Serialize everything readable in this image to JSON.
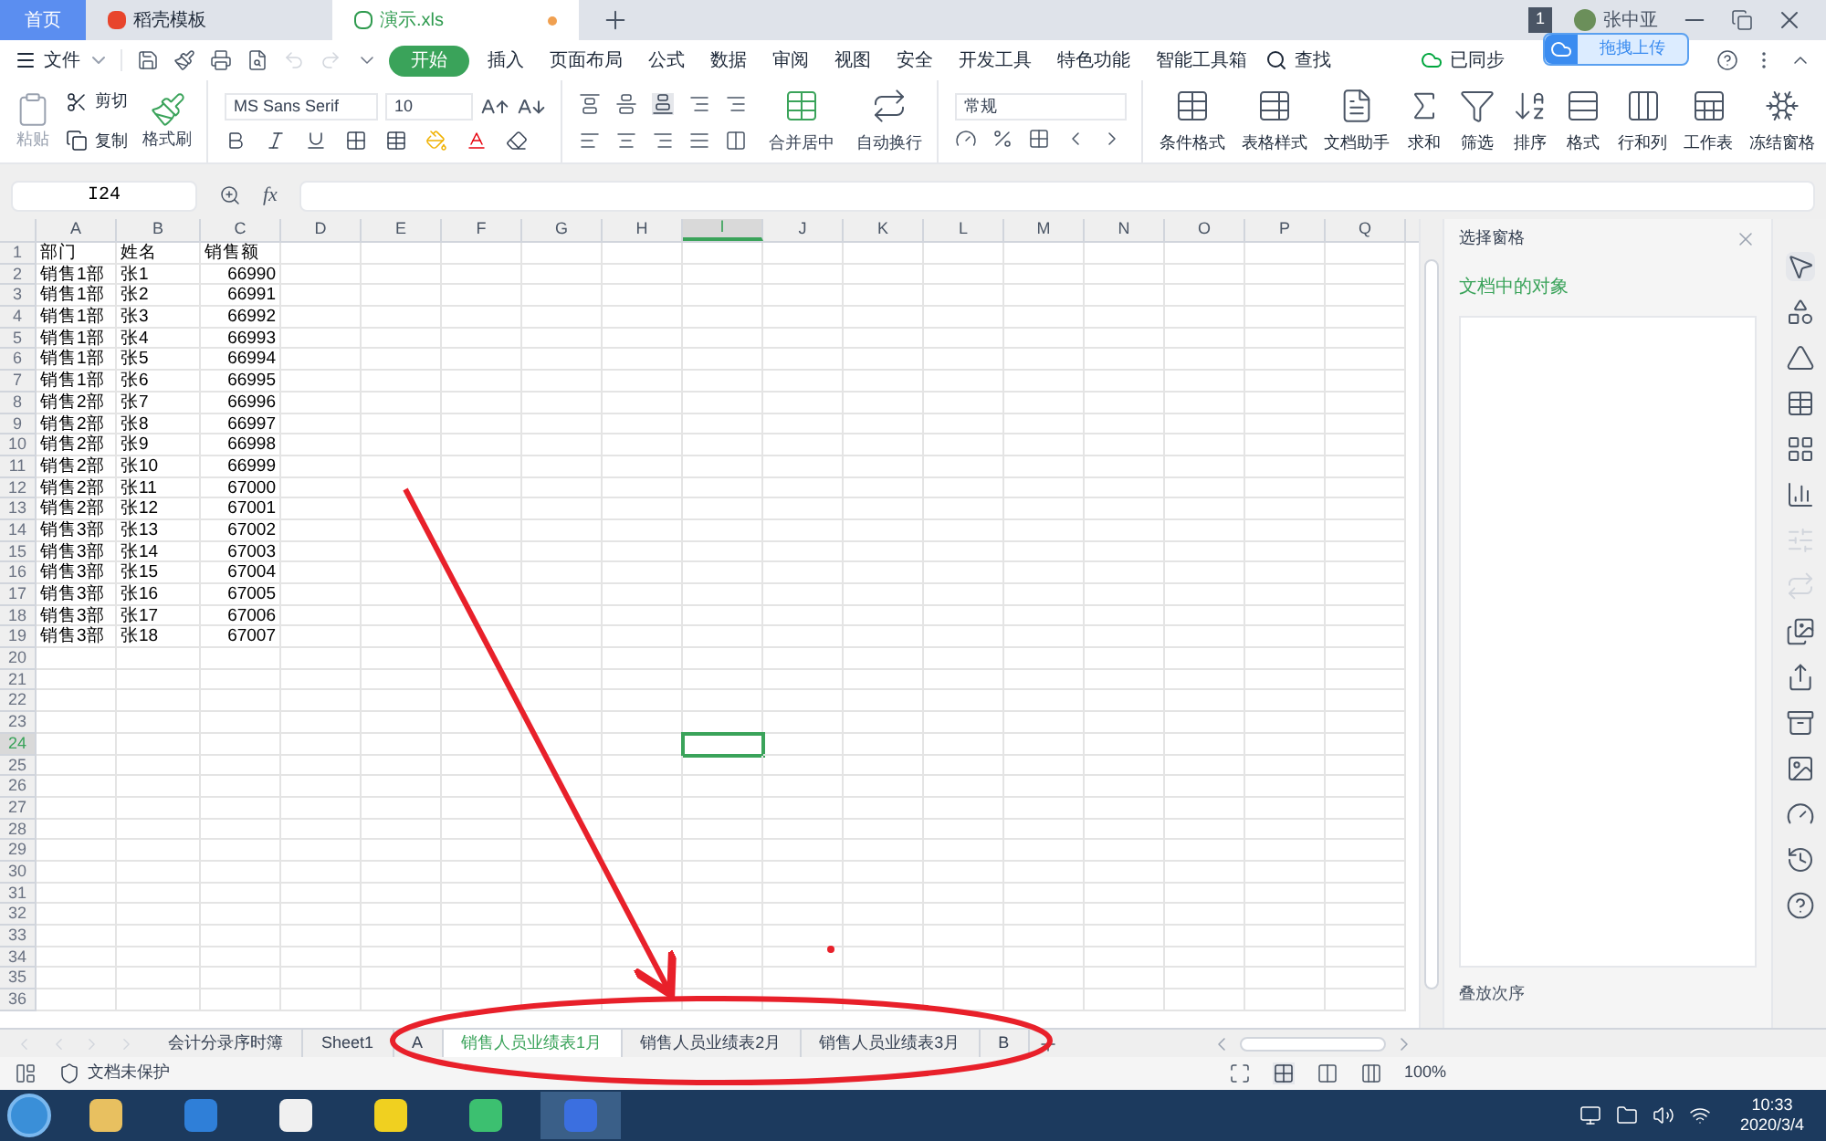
{
  "title_tabs": [
    {
      "label": "首页",
      "kind": "home",
      "selected": false
    },
    {
      "label": "稻壳模板",
      "kind": "template",
      "selected": false
    },
    {
      "label": "演示.xls",
      "kind": "sheet",
      "selected": true
    }
  ],
  "account": {
    "badge": "1",
    "user": "张中亚",
    "tooltip": "拖拽上传"
  },
  "menu": {
    "file": "文件",
    "tabs": [
      {
        "label": "开始",
        "selected": true
      },
      {
        "label": "插入",
        "selected": false
      },
      {
        "label": "页面布局",
        "selected": false
      },
      {
        "label": "公式",
        "selected": false
      },
      {
        "label": "数据",
        "selected": false
      },
      {
        "label": "审阅",
        "selected": false
      },
      {
        "label": "视图",
        "selected": false
      },
      {
        "label": "安全",
        "selected": false
      },
      {
        "label": "开发工具",
        "selected": false
      },
      {
        "label": "特色功能",
        "selected": false
      },
      {
        "label": "智能工具箱",
        "selected": false
      }
    ],
    "search": "查找",
    "sync": "已同步"
  },
  "ribbon": {
    "clipboard": {
      "paste": "粘贴",
      "cut": "剪切",
      "copy": "复制",
      "format_painter": "格式刷"
    },
    "font_name": "MS Sans Serif",
    "font_size": "10",
    "merge": "合并居中",
    "wrap": "自动换行",
    "number_format": "常规",
    "tools": [
      {
        "label": "条件格式",
        "kind": "cond"
      },
      {
        "label": "表格样式",
        "kind": "style"
      },
      {
        "label": "文档助手",
        "kind": "assist"
      },
      {
        "label": "求和",
        "kind": "sum"
      },
      {
        "label": "筛选",
        "kind": "filter"
      },
      {
        "label": "排序",
        "kind": "sort"
      },
      {
        "label": "格式",
        "kind": "format"
      },
      {
        "label": "行和列",
        "kind": "rowcol"
      },
      {
        "label": "工作表",
        "kind": "sheet"
      },
      {
        "label": "冻结窗格",
        "kind": "freeze"
      }
    ]
  },
  "formula_bar": {
    "name_box": "I24",
    "function_button": "fx"
  },
  "grid": {
    "columns": [
      {
        "label": "A",
        "selected": false
      },
      {
        "label": "B",
        "selected": false
      },
      {
        "label": "C",
        "selected": false
      },
      {
        "label": "D",
        "selected": false
      },
      {
        "label": "E",
        "selected": false
      },
      {
        "label": "F",
        "selected": false
      },
      {
        "label": "G",
        "selected": false
      },
      {
        "label": "H",
        "selected": false
      },
      {
        "label": "I",
        "selected": true
      },
      {
        "label": "J",
        "selected": false
      },
      {
        "label": "K",
        "selected": false
      },
      {
        "label": "L",
        "selected": false
      },
      {
        "label": "M",
        "selected": false
      },
      {
        "label": "N",
        "selected": false
      },
      {
        "label": "O",
        "selected": false
      },
      {
        "label": "P",
        "selected": false
      },
      {
        "label": "Q",
        "selected": false
      }
    ],
    "rows": [
      {
        "number": "1",
        "active": false,
        "cells": [
          "部门",
          "姓名",
          "销售额"
        ]
      },
      {
        "number": "2",
        "active": false,
        "cells": [
          "销售1部",
          "张1",
          "66990"
        ]
      },
      {
        "number": "3",
        "active": false,
        "cells": [
          "销售1部",
          "张2",
          "66991"
        ]
      },
      {
        "number": "4",
        "active": false,
        "cells": [
          "销售1部",
          "张3",
          "66992"
        ]
      },
      {
        "number": "5",
        "active": false,
        "cells": [
          "销售1部",
          "张4",
          "66993"
        ]
      },
      {
        "number": "6",
        "active": false,
        "cells": [
          "销售1部",
          "张5",
          "66994"
        ]
      },
      {
        "number": "7",
        "active": false,
        "cells": [
          "销售1部",
          "张6",
          "66995"
        ]
      },
      {
        "number": "8",
        "active": false,
        "cells": [
          "销售2部",
          "张7",
          "66996"
        ]
      },
      {
        "number": "9",
        "active": false,
        "cells": [
          "销售2部",
          "张8",
          "66997"
        ]
      },
      {
        "number": "10",
        "active": false,
        "cells": [
          "销售2部",
          "张9",
          "66998"
        ]
      },
      {
        "number": "11",
        "active": false,
        "cells": [
          "销售2部",
          "张10",
          "66999"
        ]
      },
      {
        "number": "12",
        "active": false,
        "cells": [
          "销售2部",
          "张11",
          "67000"
        ]
      },
      {
        "number": "13",
        "active": false,
        "cells": [
          "销售2部",
          "张12",
          "67001"
        ]
      },
      {
        "number": "14",
        "active": false,
        "cells": [
          "销售3部",
          "张13",
          "67002"
        ]
      },
      {
        "number": "15",
        "active": false,
        "cells": [
          "销售3部",
          "张14",
          "67003"
        ]
      },
      {
        "number": "16",
        "active": false,
        "cells": [
          "销售3部",
          "张15",
          "67004"
        ]
      },
      {
        "number": "17",
        "active": false,
        "cells": [
          "销售3部",
          "张16",
          "67005"
        ]
      },
      {
        "number": "18",
        "active": false,
        "cells": [
          "销售3部",
          "张17",
          "67006"
        ]
      },
      {
        "number": "19",
        "active": false,
        "cells": [
          "销售3部",
          "张18",
          "67007"
        ]
      },
      {
        "number": "20",
        "active": false
      },
      {
        "number": "21",
        "active": false
      },
      {
        "number": "22",
        "active": false
      },
      {
        "number": "23",
        "active": false
      },
      {
        "number": "24",
        "active": true
      },
      {
        "number": "25",
        "active": false
      },
      {
        "number": "26",
        "active": false
      },
      {
        "number": "27",
        "active": false
      },
      {
        "number": "28",
        "active": false
      },
      {
        "number": "29",
        "active": false
      },
      {
        "number": "30",
        "active": false
      },
      {
        "number": "31",
        "active": false
      },
      {
        "number": "32",
        "active": false
      },
      {
        "number": "33",
        "active": false
      },
      {
        "number": "34",
        "active": false
      },
      {
        "number": "35",
        "active": false
      },
      {
        "number": "36",
        "active": false
      }
    ]
  },
  "sheet_tabs": [
    {
      "label": "会计分录序时簿",
      "selected": false
    },
    {
      "label": "Sheet1",
      "selected": false
    },
    {
      "label": "A",
      "selected": false
    },
    {
      "label": "销售人员业绩表1月",
      "selected": true
    },
    {
      "label": "销售人员业绩表2月",
      "selected": false
    },
    {
      "label": "销售人员业绩表3月",
      "selected": false
    },
    {
      "label": "B",
      "selected": false
    }
  ],
  "status_bar": {
    "protection": "文档未保护",
    "zoom": "100%"
  },
  "side_panel": {
    "title": "选择窗格",
    "heading": "文档中的对象",
    "footer": "叠放次序"
  },
  "taskbar": {
    "time": "10:33",
    "date": "2020/3/4"
  }
}
